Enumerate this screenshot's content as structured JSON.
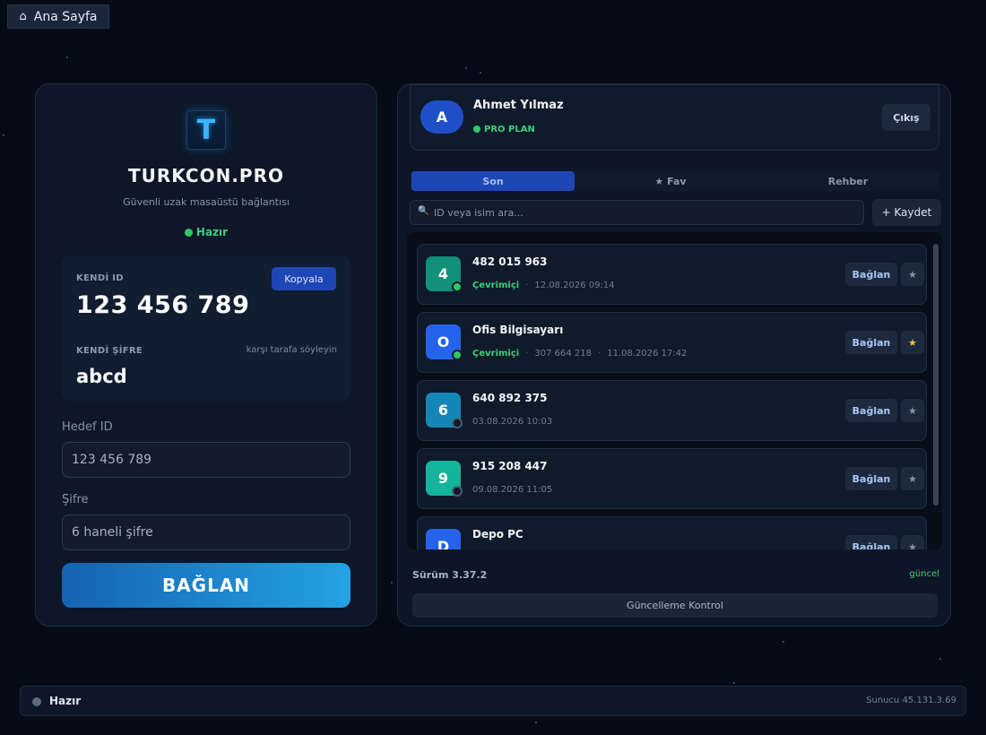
{
  "nav": {
    "home_icon": "⌂",
    "home_label": "Ana Sayfa"
  },
  "left": {
    "logo_letter": "T",
    "brand": "TURKCON.PRO",
    "tagline": "Güvenli uzak masaüstü bağlantısı",
    "status": "Hazır",
    "own_id_label": "KENDİ ID",
    "copy_label": "Kopyala",
    "own_id": "123 456 789",
    "own_pass_label": "KENDİ ŞİFRE",
    "pass_hint": "karşı tarafa söyleyin",
    "own_pass": "abcd",
    "target_id_label": "Hedef ID",
    "target_id_placeholder": "123 456 789",
    "password_label": "Şifre",
    "password_placeholder": "6 haneli şifre",
    "connect_label": "BAĞLAN"
  },
  "user": {
    "initial": "A",
    "name": "Ahmet Yılmaz",
    "plan": "PRO PLAN",
    "logout_label": "Çıkış"
  },
  "tabs": [
    {
      "label": "Son",
      "active": true
    },
    {
      "label": "★ Fav",
      "active": false
    },
    {
      "label": "Rehber",
      "active": false
    }
  ],
  "search": {
    "icon": "search-icon",
    "placeholder": "ID veya isim ara..."
  },
  "save_label": "+ Kaydet",
  "connect_label": "Bağlan",
  "fav_glyph": "★",
  "online_label": "Çevrimiçi",
  "devices": [
    {
      "initial": "4",
      "title": "482 015 963",
      "online": true,
      "id": "",
      "date": "12.08.2026 09:14",
      "starred": false,
      "color": "#12907a"
    },
    {
      "initial": "O",
      "title": "Ofis Bilgisayarı",
      "online": true,
      "id": "307 664 218",
      "date": "11.08.2026 17:42",
      "starred": true,
      "color": "#2563eb"
    },
    {
      "initial": "6",
      "title": "640 892 375",
      "online": false,
      "id": "",
      "date": "03.08.2026 10:03",
      "starred": false,
      "color": "#1487b8"
    },
    {
      "initial": "9",
      "title": "915 208 447",
      "online": false,
      "id": "",
      "date": "09.08.2026 11:05",
      "starred": false,
      "color": "#14b39b"
    },
    {
      "initial": "D",
      "title": "Depo PC",
      "online": false,
      "id": "",
      "date": "",
      "starred": false,
      "color": "#2563eb"
    }
  ],
  "footer": {
    "version": "Sürüm 3.37.2",
    "uptodate": "güncel",
    "update_label": "Güncelleme Kontrol"
  },
  "statusbar": {
    "status": "Hazır",
    "server": "Sunucu 45.131.3.69"
  }
}
